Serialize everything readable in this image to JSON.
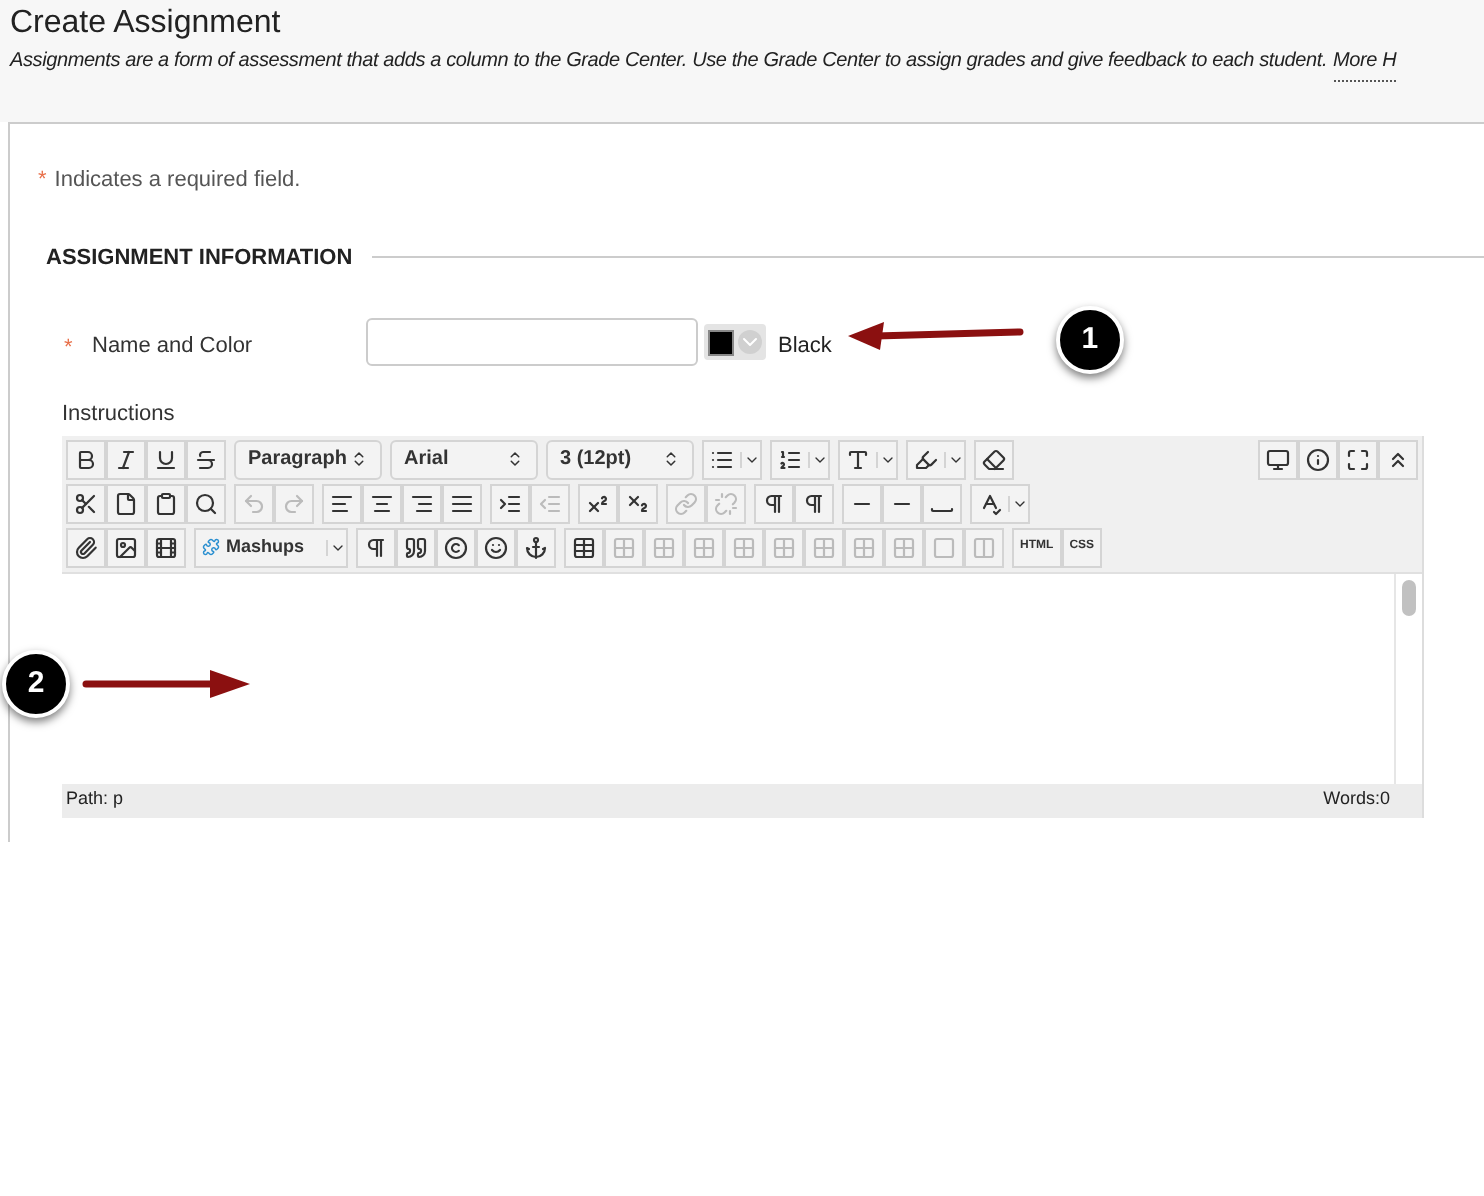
{
  "header": {
    "title": "Create Assignment",
    "description": "Assignments are a form of assessment that adds a column to the Grade Center. Use the Grade Center to assign grades and give feedback to each student.",
    "help_link": "More H"
  },
  "required_note": {
    "marker": "*",
    "text": "Indicates a required field."
  },
  "section": {
    "heading": "ASSIGNMENT INFORMATION"
  },
  "name_field": {
    "marker": "*",
    "label": "Name and Color",
    "color": "#000000",
    "color_name": "Black"
  },
  "instructions": {
    "label": "Instructions",
    "selects": [
      "Paragraph",
      "Arial",
      "3 (12pt)"
    ],
    "mashups": "Mashups",
    "code_buttons": [
      "HTML",
      "CSS"
    ],
    "path": "Path: p",
    "word_count": "Words:0"
  },
  "callouts": [
    {
      "number": "1"
    },
    {
      "number": "2"
    }
  ]
}
